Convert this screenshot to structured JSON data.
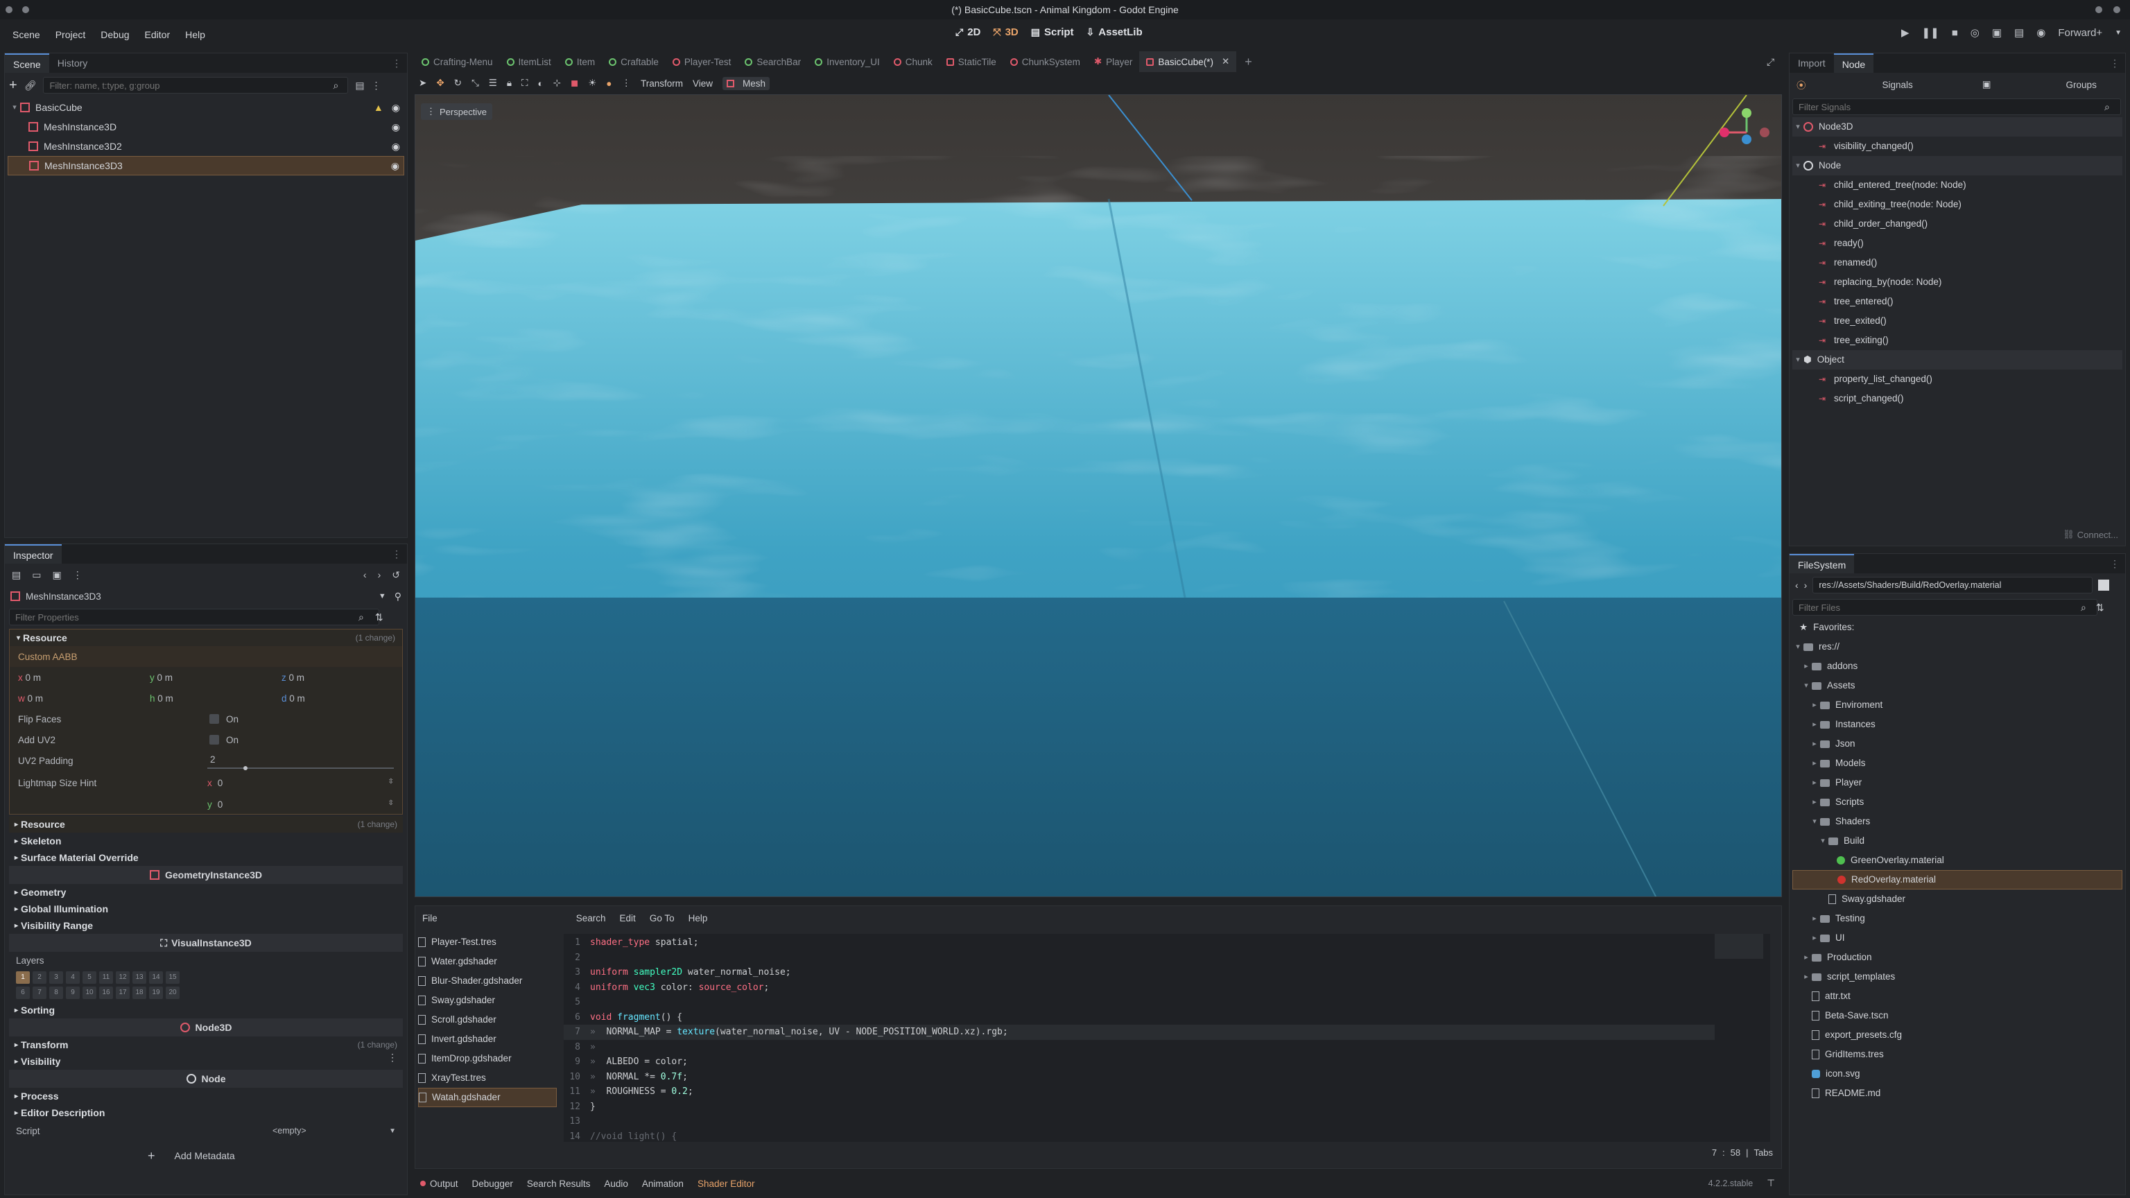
{
  "window": {
    "title": "(*) BasicCube.tscn - Animal Kingdom - Godot Engine"
  },
  "menu": [
    "Scene",
    "Project",
    "Debug",
    "Editor",
    "Help"
  ],
  "workspaces": [
    {
      "icon": "2d-icon",
      "label": "2D"
    },
    {
      "icon": "3d-icon",
      "label": "3D"
    },
    {
      "icon": "script-icon",
      "label": "Script"
    },
    {
      "icon": "assetlib-icon",
      "label": "AssetLib"
    }
  ],
  "renderer": "Forward+",
  "scene_dock": {
    "tabs": [
      "Scene",
      "History"
    ],
    "filter_placeholder": "Filter: name, t:type, g:group",
    "tree": [
      {
        "label": "BasicCube",
        "depth": 0
      },
      {
        "label": "MeshInstance3D",
        "depth": 1
      },
      {
        "label": "MeshInstance3D2",
        "depth": 1
      },
      {
        "label": "MeshInstance3D3",
        "depth": 1,
        "selected": true
      }
    ]
  },
  "scene_tabs": [
    {
      "label": "Crafting-Menu",
      "c": "g"
    },
    {
      "label": "ItemList",
      "c": "g"
    },
    {
      "label": "Item",
      "c": "g"
    },
    {
      "label": "Craftable",
      "c": "g"
    },
    {
      "label": "Player-Test",
      "c": "r"
    },
    {
      "label": "SearchBar",
      "c": "g"
    },
    {
      "label": "Inventory_UI",
      "c": "g"
    },
    {
      "label": "Chunk",
      "c": "r"
    },
    {
      "label": "StaticTile",
      "c": "r"
    },
    {
      "label": "ChunkSystem",
      "c": "r"
    },
    {
      "label": "Player",
      "c": "r"
    },
    {
      "label": "BasicCube(*)",
      "c": "r",
      "active": true
    }
  ],
  "viewport_toolbar": {
    "transform": "Transform",
    "view": "View",
    "mesh": "Mesh",
    "perspective": "Perspective"
  },
  "inspector": {
    "tab": "Inspector",
    "object": "MeshInstance3D3",
    "filter_placeholder": "Filter Properties",
    "resource_label": "Resource",
    "resource_changes": "(1 change)",
    "custom_aabb": "Custom AABB",
    "aabb": [
      [
        "x",
        "0 m"
      ],
      [
        "y",
        "0 m"
      ],
      [
        "z",
        "0 m"
      ],
      [
        "w",
        "0 m"
      ],
      [
        "h",
        "0 m"
      ],
      [
        "d",
        "0 m"
      ]
    ],
    "flip_faces": "Flip Faces",
    "add_uv2": "Add UV2",
    "on": "On",
    "uv2_padding": "UV2 Padding",
    "uv2_value": "2",
    "lightmap": "Lightmap Size Hint",
    "lm_x": "0",
    "lm_y": "0",
    "resource2": "Resource",
    "resource2_changes": "(1 change)",
    "sections1": [
      "Skeleton",
      "Surface Material Override"
    ],
    "geom": "GeometryInstance3D",
    "sections2": [
      "Geometry",
      "Global Illumination",
      "Visibility Range"
    ],
    "visual": "VisualInstance3D",
    "layers": "Layers",
    "layer_nums": [
      "1",
      "2",
      "3",
      "4",
      "5",
      "6",
      "7",
      "8",
      "9",
      "10",
      "11",
      "12",
      "13",
      "14",
      "15",
      "16",
      "17",
      "18",
      "19",
      "20"
    ],
    "sorting": "Sorting",
    "node3d": "Node3D",
    "transform": "Transform",
    "transform_changes": "(1 change)",
    "visibility": "Visibility",
    "node": "Node",
    "process": "Process",
    "editor_desc": "Editor Description",
    "script": "Script",
    "script_value": "<empty>",
    "add_metadata": "Add Metadata"
  },
  "node_dock": {
    "tabs": [
      "Import",
      "Node"
    ],
    "signals": "Signals",
    "groups": "Groups",
    "filter": "Filter Signals",
    "classes": [
      {
        "name": "Node3D",
        "signals": [
          "visibility_changed()"
        ]
      },
      {
        "name": "Node",
        "signals": [
          "child_entered_tree(node: Node)",
          "child_exiting_tree(node: Node)",
          "child_order_changed()",
          "ready()",
          "renamed()",
          "replacing_by(node: Node)",
          "tree_entered()",
          "tree_exited()",
          "tree_exiting()"
        ]
      },
      {
        "name": "Object",
        "signals": [
          "property_list_changed()",
          "script_changed()"
        ]
      }
    ],
    "connect": "Connect..."
  },
  "filesystem": {
    "tab": "FileSystem",
    "path": "res://Assets/Shaders/Build/RedOverlay.material",
    "filter": "Filter Files",
    "items": [
      {
        "label": "Favorites:",
        "d": 0,
        "t": "fav"
      },
      {
        "label": "res://",
        "d": 0,
        "t": "folder"
      },
      {
        "label": "addons",
        "d": 1,
        "t": "folder"
      },
      {
        "label": "Assets",
        "d": 1,
        "t": "folder"
      },
      {
        "label": "Enviroment",
        "d": 2,
        "t": "folder"
      },
      {
        "label": "Instances",
        "d": 2,
        "t": "folder"
      },
      {
        "label": "Json",
        "d": 2,
        "t": "folder"
      },
      {
        "label": "Models",
        "d": 2,
        "t": "folder"
      },
      {
        "label": "Player",
        "d": 2,
        "t": "folder"
      },
      {
        "label": "Scripts",
        "d": 2,
        "t": "folder"
      },
      {
        "label": "Shaders",
        "d": 2,
        "t": "folder"
      },
      {
        "label": "Build",
        "d": 3,
        "t": "folder"
      },
      {
        "label": "GreenOverlay.material",
        "d": 4,
        "t": "mat-g"
      },
      {
        "label": "RedOverlay.material",
        "d": 4,
        "t": "mat-r",
        "sel": true
      },
      {
        "label": "Sway.gdshader",
        "d": 3,
        "t": "file"
      },
      {
        "label": "Testing",
        "d": 2,
        "t": "folder"
      },
      {
        "label": "UI",
        "d": 2,
        "t": "folder"
      },
      {
        "label": "Production",
        "d": 1,
        "t": "folder"
      },
      {
        "label": "script_templates",
        "d": 1,
        "t": "folder"
      },
      {
        "label": "attr.txt",
        "d": 1,
        "t": "file"
      },
      {
        "label": "Beta-Save.tscn",
        "d": 1,
        "t": "file"
      },
      {
        "label": "export_presets.cfg",
        "d": 1,
        "t": "file"
      },
      {
        "label": "GridItems.tres",
        "d": 1,
        "t": "file"
      },
      {
        "label": "icon.svg",
        "d": 1,
        "t": "file"
      },
      {
        "label": "README.md",
        "d": 1,
        "t": "file"
      }
    ]
  },
  "shader_editor": {
    "menus": [
      "File"
    ],
    "menus2": [
      "Search",
      "Edit",
      "Go To",
      "Help"
    ],
    "files": [
      "Player-Test.tres",
      "Water.gdshader",
      "Blur-Shader.gdshader",
      "Sway.gdshader",
      "Scroll.gdshader",
      "Invert.gdshader",
      "ItemDrop.gdshader",
      "XrayTest.tres",
      "Watah.gdshader"
    ],
    "active_file": "Watah.gdshader",
    "status": {
      "line": "7",
      "col": "58",
      "indent": "Tabs"
    }
  },
  "bottom_tabs": [
    "Output",
    "Debugger",
    "Search Results",
    "Audio",
    "Animation",
    "Shader Editor"
  ],
  "version": "4.2.2.stable",
  "colors": {
    "accent": "#5a8fd8",
    "selection": "#4a3a2c",
    "signal": "#e05a6b",
    "tab_green": "#6cc46f"
  }
}
